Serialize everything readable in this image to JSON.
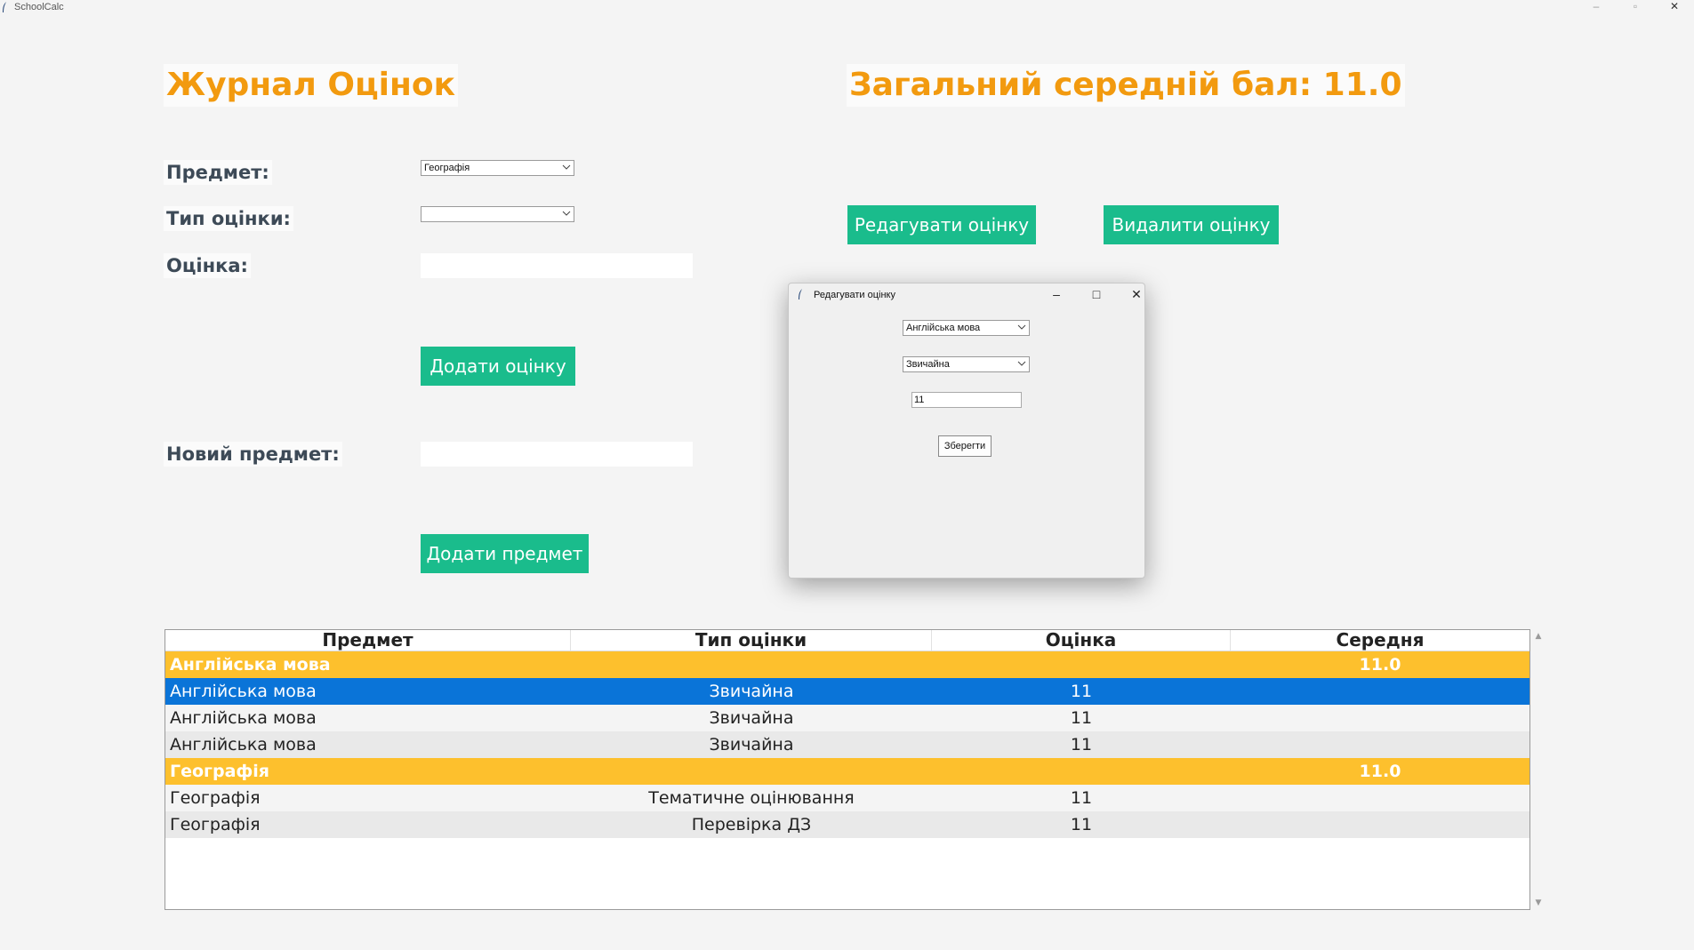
{
  "window": {
    "title": "SchoolCalc"
  },
  "header": {
    "journal_title": "Журнал Оцінок",
    "overall_average": "Загальний середній бал: 11.0"
  },
  "form": {
    "subject_label": "Предмет:",
    "subject_value": "Географія",
    "grade_type_label": "Тип оцінки:",
    "grade_type_value": "",
    "grade_label": "Оцінка:",
    "grade_value": "",
    "add_grade_button": "Додати оцінку",
    "new_subject_label": "Новий предмет:",
    "new_subject_value": "",
    "add_subject_button": "Додати предмет"
  },
  "actions": {
    "edit_grade_button": "Редагувати оцінку",
    "delete_grade_button": "Видалити оцінку"
  },
  "dialog": {
    "title": "Редагувати оцінку",
    "subject_value": "Англійська мова",
    "type_value": "Звичайна",
    "grade_value": "11",
    "save_button": "Зберегти"
  },
  "table": {
    "columns": [
      "Предмет",
      "Тип оцінки",
      "Оцінка",
      "Середня"
    ],
    "rows": [
      {
        "kind": "group",
        "subject": "Англійська мова",
        "type": "",
        "grade": "",
        "average": "11.0"
      },
      {
        "kind": "selected",
        "subject": "Англійська мова",
        "type": "Звичайна",
        "grade": "11",
        "average": ""
      },
      {
        "kind": "odd",
        "subject": "Англійська мова",
        "type": "Звичайна",
        "grade": "11",
        "average": ""
      },
      {
        "kind": "even",
        "subject": "Англійська мова",
        "type": "Звичайна",
        "grade": "11",
        "average": ""
      },
      {
        "kind": "group",
        "subject": "Географія",
        "type": "",
        "grade": "",
        "average": "11.0"
      },
      {
        "kind": "odd",
        "subject": "Географія",
        "type": "Тематичне оцінювання",
        "grade": "11",
        "average": ""
      },
      {
        "kind": "even",
        "subject": "Географія",
        "type": "Перевірка ДЗ",
        "grade": "11",
        "average": ""
      }
    ]
  },
  "colors": {
    "heading": "#f29a0f",
    "button": "#1abc8c",
    "group_row": "#fdc02d",
    "selected_row": "#0a74d8"
  }
}
